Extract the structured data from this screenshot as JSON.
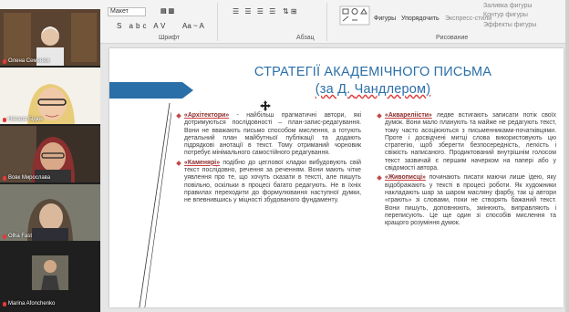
{
  "ribbon": {
    "font_name": "Макет",
    "font_group": "Шрифт",
    "paragraph_group": "Абзац",
    "drawing_group": "Рисование",
    "shapes_label": "Фигуры",
    "arrange_label": "Упорядочить",
    "quick_styles_label": "Экспресс-стили",
    "shape_fill_label": "Заливка фигуры",
    "shape_outline_label": "Контур фигуры",
    "shape_effects_label": "Эффекты фигуры"
  },
  "participants": [
    {
      "name": "Олена Семенюк"
    },
    {
      "name": "Наталя Бідюк"
    },
    {
      "name": "Вовк Мирослава"
    },
    {
      "name": "Olha Fast"
    },
    {
      "name": "Marina Afonchenko"
    }
  ],
  "slide": {
    "title_line1": "СТРАТЕГІЇ АКАДЕМІЧНОГО ПИСЬМА",
    "title_line2_prefix": "(за Д. ",
    "title_line2_name": "Чандлером",
    "title_line2_suffix": ")",
    "left": [
      {
        "term": "«Архітектори»",
        "text": " - найбільш прагматичні автори, які дотримуються послідовності – план-запис-редагування. Вони не вважають письмо способом мислення, а готують детальний план майбутньої публікації та додають підрядкові анотації в текст. Тому отриманий чорновик потребує мінімального самостійного редагування."
      },
      {
        "term": "«Каменярі»",
        "text": " подібно до цеглової кладки вибудовують свій текст послідовно, речення за реченням. Вони мають чітке уявлення про те, що хочуть сказати в тексті, але пишуть повільно, оскільки в процесі багато редагують. Не в їхніх правилах переходити до формулювання наступної думки, не впевнившись у міцності збудованого фундаменту."
      }
    ],
    "right": [
      {
        "term": "«Аквареліісти»",
        "text": " ледве встигають записати потік своїх думок. Вони мало планують та майже не редагують текст, тому часто асоціюються з письменниками-початківцями. Проте і досвідчені митці слова використовують цю стратегію, щоб зберегти безпосередність, легкість і свіжість написаного. Продиктований внутрішнім голосом текст зазвичай є першим начерком на папері або у свідомості автора."
      },
      {
        "term": "«Живописці»",
        "text": " починають писати маючи лише ідею, яку відображають у тексті в процесі роботи. Як художники накладають шар за шаром масляну фарбу, так ці автори «грають» зі словами, поки не створять бажаний текст. Вони пишуть, доповнюють, змінюють, виправляють і переписують. Це ще один зі способів мислення та кращого розуміння думок."
      }
    ]
  },
  "colors": {
    "title": "#2b6fa8",
    "arrow": "#2b6fa8",
    "bullet": "#c24a4a"
  }
}
